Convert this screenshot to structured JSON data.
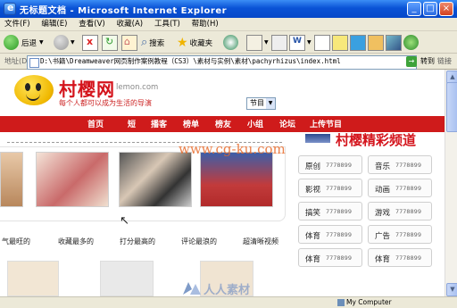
{
  "window": {
    "title": "无标题文档 - Microsoft Internet Explorer",
    "controls": [
      "_",
      "□",
      "×"
    ]
  },
  "menu": [
    "文件(F)",
    "编辑(E)",
    "查看(V)",
    "收藏(A)",
    "工具(T)",
    "帮助(H)"
  ],
  "toolbar": {
    "back": "后退",
    "search": "搜索",
    "favorites": "收藏夹"
  },
  "address": {
    "label": "地址(D)",
    "url": "D:\\书籍\\Dreamweaver网页制作案例教程（CS3）\\素材与实例\\素材\\pachyrhizus\\index.html",
    "go": "转到",
    "links": "链接"
  },
  "site": {
    "logo_cn": "村樱网",
    "logo_en": "lemon.com",
    "slogan": "每个人都可以成为生活的导演",
    "select_value": "节目",
    "nav": [
      "首页",
      "短",
      "播客",
      "榜单",
      "榜友",
      "小组",
      "论坛",
      "上传节目"
    ],
    "channel_title": "村樱精彩频道",
    "watermark": "www.cg-ku.com",
    "categories": [
      "气最旺的",
      "收藏最多的",
      "打分最高的",
      "评论最浪的",
      "超清晰视频"
    ],
    "channels": [
      {
        "name": "原创",
        "value": "7778899"
      },
      {
        "name": "音乐",
        "value": "7778899"
      },
      {
        "name": "影视",
        "value": "7778899"
      },
      {
        "name": "动画",
        "value": "7778899"
      },
      {
        "name": "搞笑",
        "value": "7778899"
      },
      {
        "name": "游戏",
        "value": "7778899"
      },
      {
        "name": "体育",
        "value": "7778899"
      },
      {
        "name": "广告",
        "value": "7778899"
      },
      {
        "name": "体育",
        "value": "7778899"
      },
      {
        "name": "体育",
        "value": "7778899"
      }
    ],
    "bottom_watermark": "人人素材"
  },
  "status": {
    "zone": "My Computer"
  },
  "colors": {
    "title_bar": "#0a53d6",
    "nav_red": "#cf1b1b",
    "logo_red": "#d4141c"
  }
}
